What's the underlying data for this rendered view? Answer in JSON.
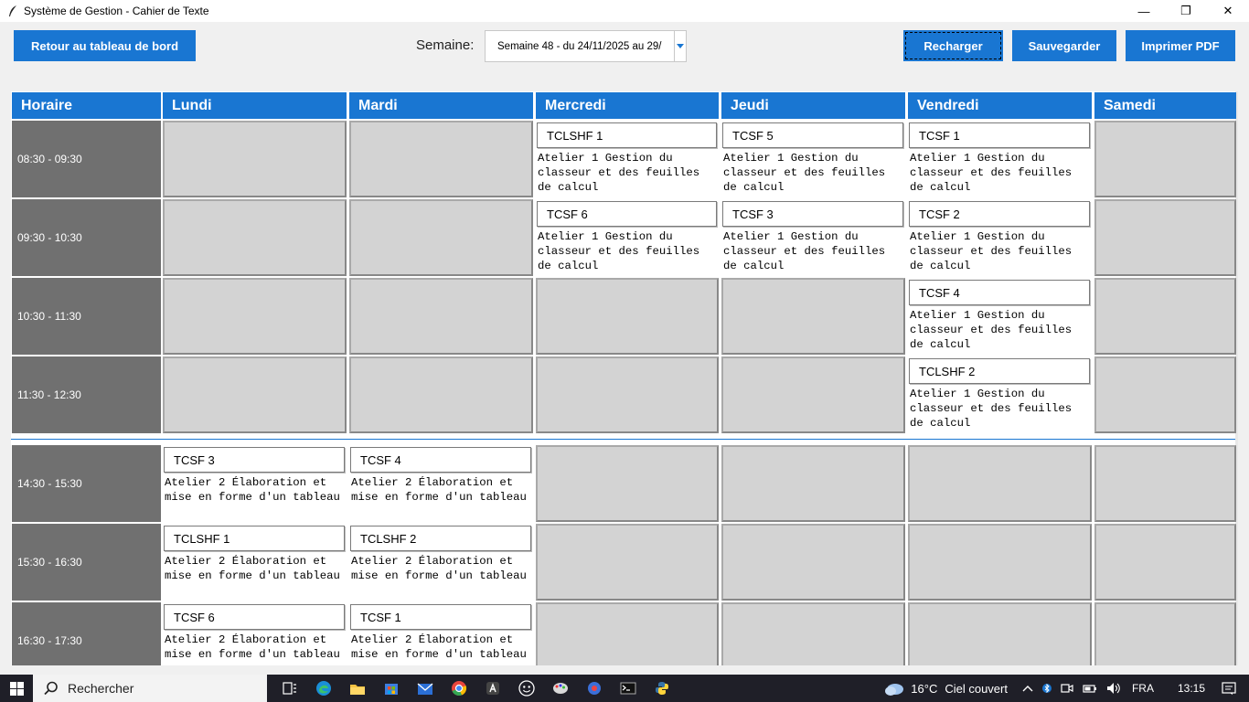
{
  "window": {
    "title": "Système de Gestion - Cahier de Texte",
    "minimize": "—",
    "maximize": "❐",
    "close": "✕"
  },
  "toolbar": {
    "back_label": "Retour au tableau de bord",
    "week_label": "Semaine:",
    "week_value": "Semaine 48 - du 24/11/2025 au 29/",
    "reload_label": "Recharger",
    "save_label": "Sauvegarder",
    "print_label": "Imprimer PDF"
  },
  "grid": {
    "headers": [
      "Horaire",
      "Lundi",
      "Mardi",
      "Mercredi",
      "Jeudi",
      "Vendredi",
      "Samedi"
    ],
    "times": [
      "08:30 - 09:30",
      "09:30 - 10:30",
      "10:30 - 11:30",
      "11:30 - 12:30",
      "14:30 - 15:30",
      "15:30 - 16:30",
      "16:30 - 17:30"
    ],
    "rows": [
      [
        null,
        null,
        {
          "cls": "TCLSHF 1",
          "desc": "Atelier 1 Gestion du classeur et des feuilles de calcul"
        },
        {
          "cls": "TCSF 5",
          "desc": "Atelier 1 Gestion du classeur et des feuilles de calcul"
        },
        {
          "cls": "TCSF 1",
          "desc": "Atelier 1 Gestion du classeur et des feuilles de calcul"
        },
        null
      ],
      [
        null,
        null,
        {
          "cls": "TCSF 6",
          "desc": "Atelier 1 Gestion du classeur et des feuilles de calcul"
        },
        {
          "cls": "TCSF 3",
          "desc": "Atelier 1 Gestion du classeur et des feuilles de calcul"
        },
        {
          "cls": "TCSF 2",
          "desc": "Atelier 1 Gestion du classeur et des feuilles de calcul"
        },
        null
      ],
      [
        null,
        null,
        null,
        null,
        {
          "cls": "TCSF 4",
          "desc": "Atelier 1 Gestion du classeur et des feuilles de calcul"
        },
        null
      ],
      [
        null,
        null,
        null,
        null,
        {
          "cls": "TCLSHF 2",
          "desc": "Atelier 1 Gestion du classeur et des feuilles de calcul"
        },
        null
      ],
      [
        {
          "cls": "TCSF 3",
          "desc": "Atelier 2 Élaboration et mise en forme d'un tableau"
        },
        {
          "cls": "TCSF 4",
          "desc": "Atelier 2 Élaboration et mise en forme d'un tableau"
        },
        null,
        null,
        null,
        null
      ],
      [
        {
          "cls": "TCLSHF 1",
          "desc": "Atelier 2 Élaboration et mise en forme d'un tableau"
        },
        {
          "cls": "TCLSHF 2",
          "desc": "Atelier 2 Élaboration et mise en forme d'un tableau"
        },
        null,
        null,
        null,
        null
      ],
      [
        {
          "cls": "TCSF 6",
          "desc": "Atelier 2 Élaboration et mise en forme d'un tableau"
        },
        {
          "cls": "TCSF 1",
          "desc": "Atelier 2 Élaboration et mise en forme d'un tableau"
        },
        null,
        null,
        null,
        null
      ]
    ]
  },
  "taskbar": {
    "search_label": "Rechercher",
    "weather_temp": "16°C",
    "weather_text": "Ciel couvert",
    "lang": "FRA",
    "time": "13:15"
  },
  "colors": {
    "accent": "#1976d2",
    "time_cell": "#707070",
    "empty_cell": "#d3d3d3"
  }
}
